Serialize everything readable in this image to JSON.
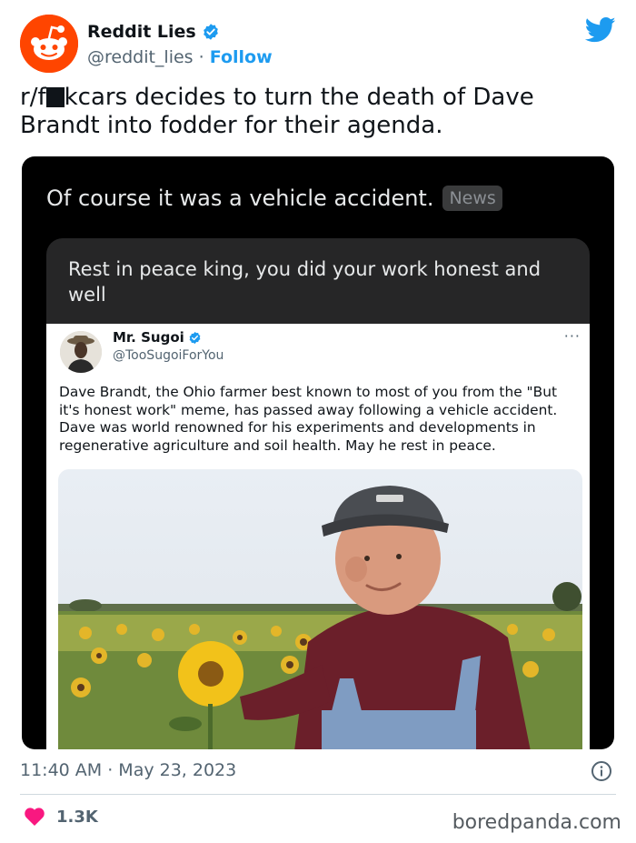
{
  "tweet": {
    "display_name": "Reddit Lies",
    "handle": "@reddit_lies",
    "separator": "·",
    "follow_label": "Follow",
    "text_before_censor": "r/f",
    "text_after_censor": "kcars decides to turn the death of Dave Brandt into fodder for their agenda.",
    "timestamp": "11:40 AM · May 23, 2023",
    "like_count": "1.3K"
  },
  "embedded_post": {
    "headline": "Of course it was a vehicle accident.",
    "badge": "News",
    "comment": "Rest in peace king, you did your work honest and well",
    "inner_tweet": {
      "display_name": "Mr. Sugoi",
      "handle": "@TooSugoiForYou",
      "more": "···",
      "text": "Dave Brandt, the Ohio farmer best known to most of you from the \"But it's honest work\" meme, has passed away following a vehicle accident. Dave was world renowned for his experiments and developments in regenerative agriculture and soil health. May he rest in peace."
    }
  },
  "watermark": "boredpanda.com",
  "colors": {
    "accent": "#1d9bf0",
    "reddit_orange": "#ff4500",
    "like_red": "#f91880",
    "muted_text": "#536471"
  },
  "icons": {
    "avatar": "reddit-alien-logo",
    "verified": "verified-badge-icon",
    "platform": "twitter-bird-icon",
    "info": "info-icon",
    "like": "heart-icon"
  }
}
